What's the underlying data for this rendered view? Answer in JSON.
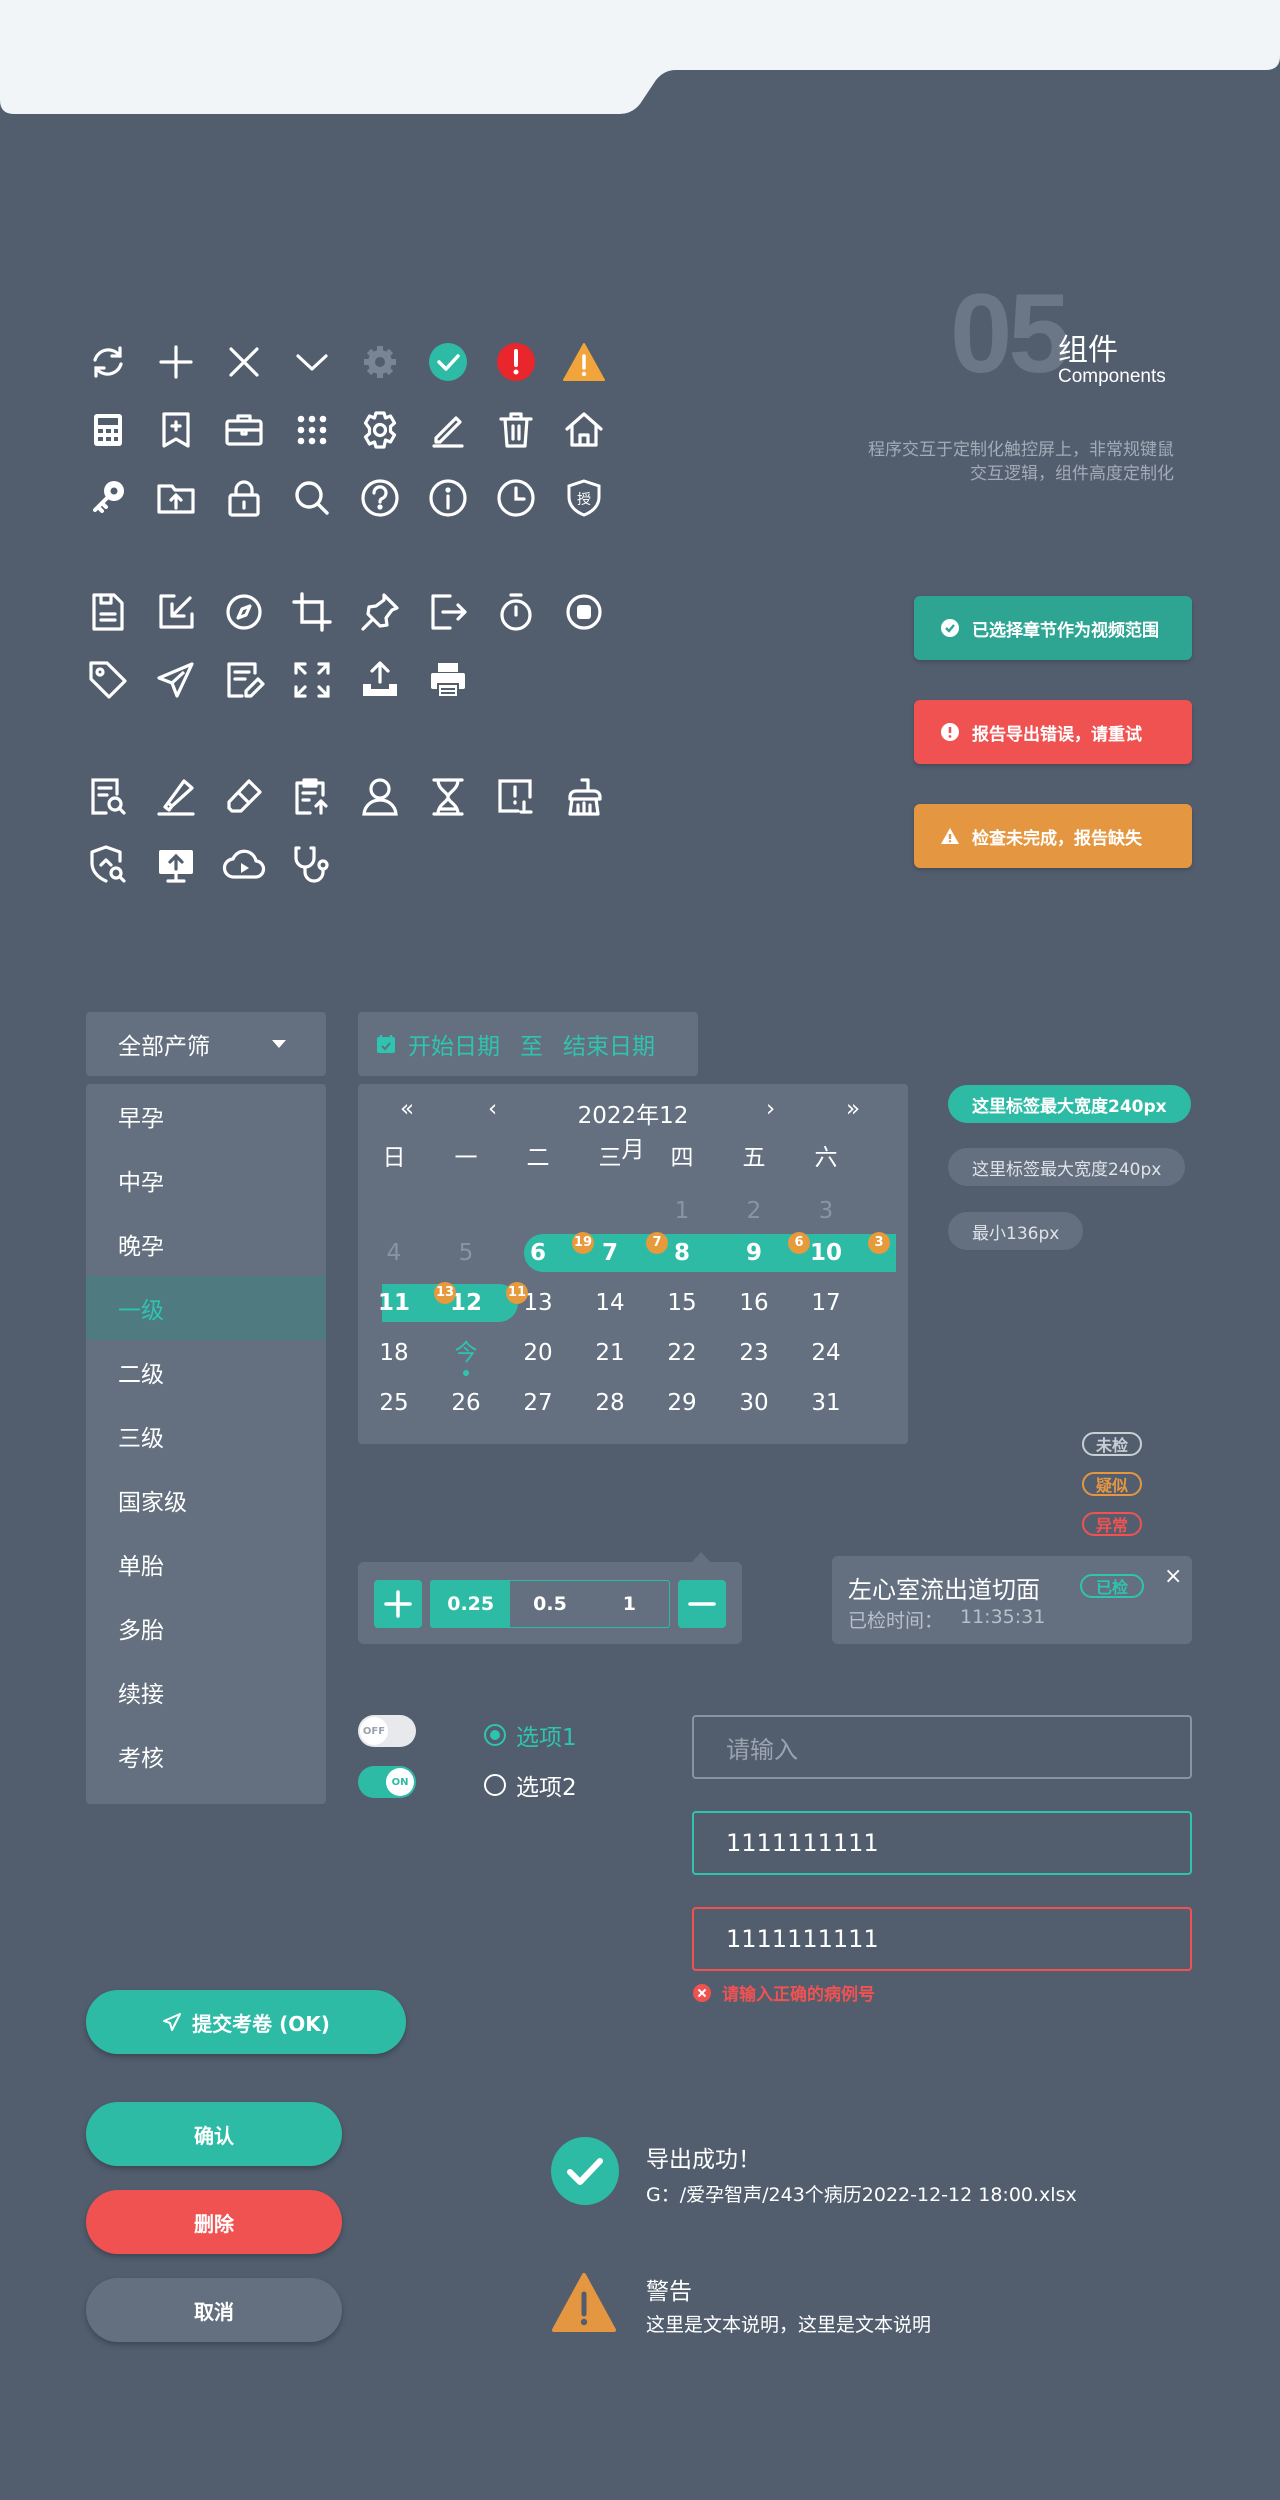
{
  "header": {
    "section_number": "05",
    "section_title": "组件",
    "section_subtitle": "Components",
    "description_line1": "程序交互于定制化触控屏上，非常规键鼠",
    "description_line2": "交互逻辑，组件高度定制化"
  },
  "icons": {
    "row1": [
      "refresh-icon",
      "plus-icon",
      "close-icon",
      "chevron-down-icon",
      "gear-icon",
      "check-circle-icon",
      "error-circle-icon",
      "warning-triangle-icon"
    ],
    "row2": [
      "calculator-icon",
      "bookmark-icon",
      "briefcase-icon",
      "grid-dots-icon",
      "settings-icon",
      "edit-pen-icon",
      "trash-icon",
      "home-icon"
    ],
    "row3": [
      "key-icon",
      "folder-upload-icon",
      "lock-icon",
      "search-icon",
      "help-circle-icon",
      "info-circle-icon",
      "clock-icon",
      "shield-auth-icon"
    ],
    "row4": [
      "save-file-icon",
      "import-arrow-icon",
      "compass-icon",
      "crop-icon",
      "pin-icon",
      "logout-icon",
      "timer-icon",
      "stop-circle-icon"
    ],
    "row5": [
      "tag-icon",
      "send-icon",
      "note-edit-icon",
      "fullscreen-icon",
      "upload-tray-icon",
      "printer-icon"
    ],
    "row6": [
      "doc-search-icon",
      "highlighter-icon",
      "eraser-icon",
      "clipboard-upload-icon",
      "user-icon",
      "hourglass-icon",
      "report-alert-icon",
      "cleaning-brush-icon"
    ],
    "row7": [
      "shield-search-icon",
      "monitor-upload-icon",
      "cloud-play-icon",
      "stethoscope-icon"
    ],
    "auth_glyph": "授"
  },
  "alerts": {
    "success": "已选择章节作为视频范围",
    "error": "报告导出错误，请重试",
    "warning": "检查未完成，报告缺失"
  },
  "dropdown": {
    "selected": "全部产筛",
    "options": [
      "早孕",
      "中孕",
      "晚孕",
      "一级",
      "二级",
      "三级",
      "国家级",
      "单胎",
      "多胎",
      "续接",
      "考核"
    ],
    "active_index": 3
  },
  "date_range": {
    "start": "开始日期",
    "separator": "至",
    "end": "结束日期"
  },
  "calendar": {
    "month": "2022年12月",
    "nav": {
      "prev_year": "«",
      "prev_month": "‹",
      "next_month": "›",
      "next_year": "»"
    },
    "weekdays": [
      "日",
      "一",
      "二",
      "三",
      "四",
      "五",
      "六"
    ],
    "days": {
      "d1": "1",
      "d2": "2",
      "d3": "3",
      "d4": "4",
      "d5": "5",
      "d6": "6",
      "d7": "7",
      "d8": "8",
      "d9": "9",
      "d10": "10",
      "d11": "11",
      "d12": "12",
      "d13": "13",
      "d14": "14",
      "d15": "15",
      "d16": "16",
      "d17": "17",
      "d18": "18",
      "today": "今",
      "d20": "20",
      "d21": "21",
      "d22": "22",
      "d23": "23",
      "d24": "24",
      "d25": "25",
      "d26": "26",
      "d27": "27",
      "d28": "28",
      "d29": "29",
      "d30": "30",
      "d31": "31"
    },
    "badges": {
      "b6": "19",
      "b7": "7",
      "b9": "6",
      "b10": "3",
      "b11": "13",
      "b12": "11"
    }
  },
  "tags": {
    "filled": "这里标签最大宽度240px",
    "outline": "这里标签最大宽度240px",
    "min": "最小136px"
  },
  "status_tags": {
    "unchecked": "未检",
    "suspect": "疑似",
    "abnormal": "异常",
    "checked": "已检"
  },
  "stepper": {
    "values": [
      "0.25",
      "0.5",
      "1"
    ]
  },
  "notice_card": {
    "title": "左心室流出道切面",
    "label": "已检时间：",
    "time": "11:35:31",
    "close": "×"
  },
  "toggles": {
    "off": "OFF",
    "on": "ON"
  },
  "radios": {
    "option1": "选项1",
    "option2": "选项2"
  },
  "inputs": {
    "placeholder": "请输入",
    "focused_value": "1111111111",
    "error_value": "1111111111",
    "error_message": "请输入正确的病例号"
  },
  "buttons": {
    "submit": "提交考卷 (OK)",
    "confirm": "确认",
    "delete": "删除",
    "cancel": "取消"
  },
  "messages": {
    "success_title": "导出成功！",
    "success_path": "G：/爱孕智声/243个病历2022-12-12 18:00.xlsx",
    "warning_title": "警告",
    "warning_text": "这里是文本说明，这里是文本说明"
  },
  "colors": {
    "background": "#525e6e",
    "teal": "#2ebba6",
    "red": "#f05252",
    "orange": "#e59640",
    "panel": "#64707f",
    "badge": "#e79a3b"
  }
}
